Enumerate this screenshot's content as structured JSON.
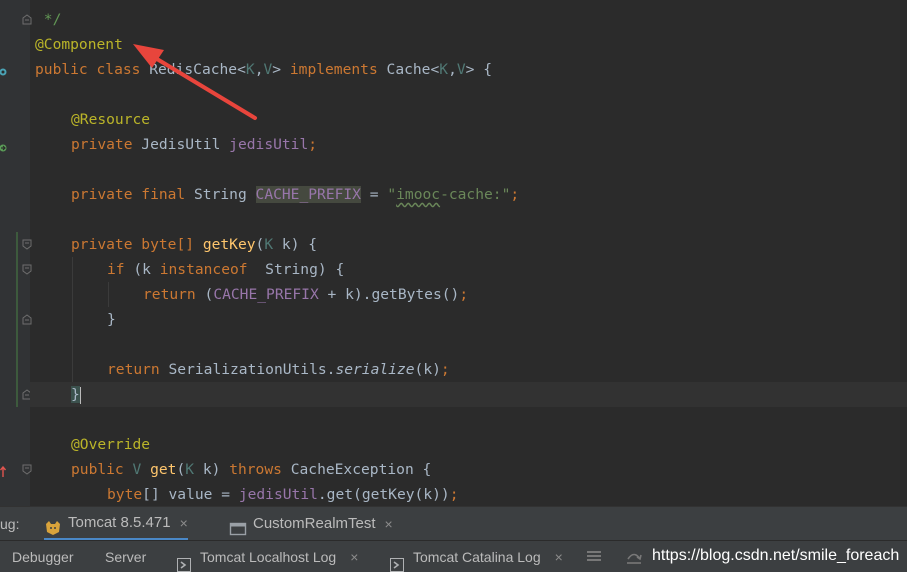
{
  "editor": {
    "lines": {
      "l1": {
        "text": " */"
      },
      "l2": {
        "annotation": "@Component"
      },
      "l3": {
        "kw": "public class ",
        "name": "RedisCache",
        "lt": "<",
        "k": "K",
        "comma": ",",
        "v": "V",
        "gt": "> ",
        "impl": "implements ",
        "iface": "Cache",
        "lt2": "<",
        "k2": "K",
        "comma2": ",",
        "v2": "V",
        "gt2": "> {"
      },
      "l5": {
        "annotation": "@Resource"
      },
      "l6": {
        "kw": "private ",
        "type": "JedisUtil ",
        "field": "jedisUtil",
        "end": ";"
      },
      "l8": {
        "kw": "private final ",
        "type": "String ",
        "field": "CACHE_PREFIX",
        "eq": " = ",
        "q1": "\"",
        "s1": "imooc",
        "s2": "-cache:",
        "q2": "\"",
        "end": ";"
      },
      "l10": {
        "kw": "private ",
        "type": "byte",
        "type2": "[] ",
        "method": "getKey",
        "p1": "(",
        "k": "K",
        "param": " k",
        "p2": ") {"
      },
      "l11": {
        "kw": "if ",
        "p1": "(k ",
        "kw2": "instanceof  ",
        "type": "String",
        "p2": ") {"
      },
      "l12": {
        "kw": "return ",
        "p1": "(",
        "field": "CACHE_PREFIX",
        "rest": " + k).getBytes",
        "p2": "()",
        "end": ";"
      },
      "l13": {
        "text": "}"
      },
      "l15": {
        "kw": "return ",
        "cls": "SerializationUtils.",
        "method": "serialize",
        "rest": "(k)",
        "end": ";"
      },
      "l16": {
        "text": "}"
      },
      "l18": {
        "annotation": "@Override"
      },
      "l19": {
        "kw": "public ",
        "v": "V ",
        "method": "get",
        "p1": "(",
        "k": "K",
        "param": " k) ",
        "kw2": "throws ",
        "type": "CacheException ",
        "end": "{"
      },
      "l20": {
        "kw": "byte",
        "type": "[] value = ",
        "field": "jedisUtil",
        "rest": ".get(getKey(k))",
        "end": ";"
      }
    }
  },
  "debug_bar": {
    "label": "ug:",
    "tabs": [
      {
        "label": "Tomcat 8.5.471",
        "icon": "tomcat-icon",
        "close": "×"
      },
      {
        "label": "CustomRealmTest",
        "icon": "console-icon",
        "close": "×"
      }
    ]
  },
  "sub_bar": {
    "tabs": [
      {
        "label": "Debugger"
      },
      {
        "label": "Server"
      },
      {
        "label": "Tomcat Localhost Log",
        "icon": "log-icon",
        "close": "×"
      },
      {
        "label": "Tomcat Catalina Log",
        "icon": "log-icon",
        "close": "×"
      }
    ],
    "watermark": "https://blog.csdn.net/smile_foreach"
  },
  "colors": {
    "background": "#2b2b2b",
    "keyword": "#cc7832",
    "annotation": "#bbb529",
    "field": "#9876aa",
    "string": "#6a8759",
    "arrow": "#e8453c",
    "active_tab": "#4a88c7"
  }
}
